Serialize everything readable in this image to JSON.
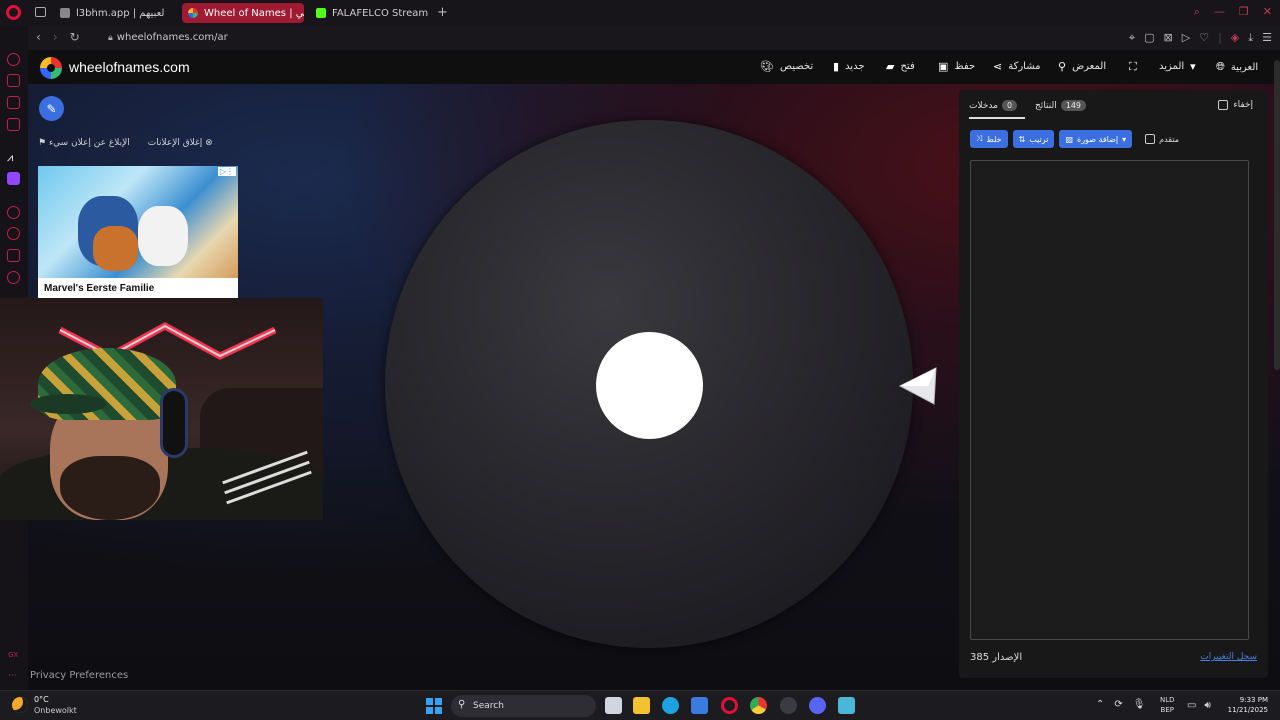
{
  "browser": {
    "tabs": [
      {
        "title": "l3bhm.app | لعبيهم",
        "icon": "l3bhm-tab-icon",
        "active": false
      },
      {
        "title": "Wheel of Names | عشوائي",
        "icon": "wheel-tab-icon",
        "active": true
      },
      {
        "title": "FALAFELCO Stream - Wat",
        "icon": "kick-tab-icon",
        "active": false
      }
    ],
    "new_tab": "+",
    "url": "wheelofnames.com/ar"
  },
  "site": {
    "name": "wheelofnames.com",
    "nav": {
      "customize": "تخصيص",
      "new": "جديد",
      "open": "فتح",
      "save": "حفظ",
      "share": "مشاركة",
      "gallery": "المعرض",
      "more": "المزيد",
      "language": "العربية"
    }
  },
  "ads": {
    "close_ads": "إغلاق الإعلانات",
    "report_ad": "الإبلاغ عن إعلان سيء",
    "ad_title": "Marvel's Eerste Familie"
  },
  "panel": {
    "entries_tab": "مدخلات",
    "entries_count": "0",
    "results_tab": "النتائج",
    "results_count": "149",
    "hide_label": "إخفاء",
    "shuffle": "خلط",
    "sort": "ترتيب",
    "add_image": "إضافة صورة",
    "advanced": "متقدم",
    "version": "الإصدار 385",
    "changelog": "سجل التغييرات"
  },
  "footer": {
    "privacy": "Privacy Preferences"
  },
  "taskbar": {
    "weather_temp": "0°C",
    "weather_desc": "Onbewolkt",
    "search": "Search",
    "lang_top": "NLD",
    "lang_bottom": "BEP",
    "time": "9:33 PM",
    "date": "11/21/2025"
  },
  "colors": {
    "accent_blue": "#3b6fe0",
    "opera_red": "#e0103a",
    "active_tab": "#9e1b32"
  }
}
